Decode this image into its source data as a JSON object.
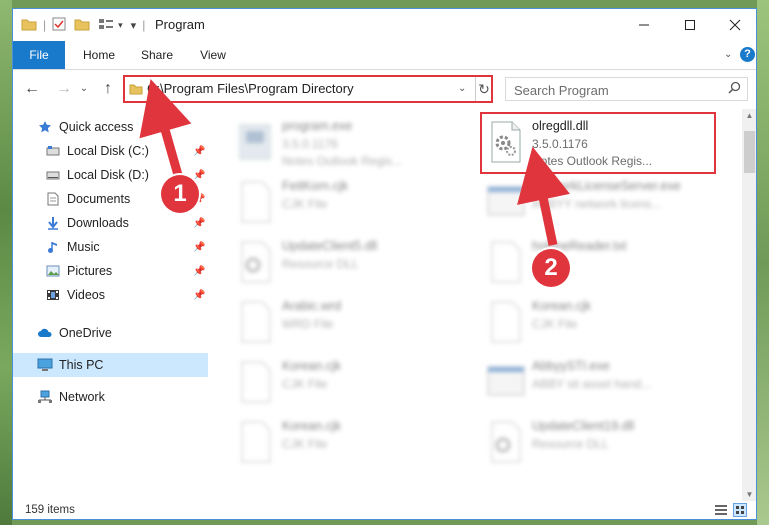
{
  "window": {
    "title": "Program"
  },
  "ribbon": {
    "tabs": [
      "File",
      "Home",
      "Share",
      "View"
    ]
  },
  "nav": {
    "address_path": "C:\\Program Files\\Program Directory",
    "search_placeholder": "Search Program"
  },
  "sidebar": {
    "items": [
      {
        "label": "Quick access",
        "icon": "star-icon"
      },
      {
        "label": "Local Disk (C:)",
        "icon": "drive-icon",
        "pinned": true
      },
      {
        "label": "Local Disk (D:)",
        "icon": "drive-icon",
        "pinned": true
      },
      {
        "label": "Documents",
        "icon": "documents-icon",
        "pinned": true
      },
      {
        "label": "Downloads",
        "icon": "download-icon",
        "pinned": true
      },
      {
        "label": "Music",
        "icon": "music-icon",
        "pinned": true
      },
      {
        "label": "Pictures",
        "icon": "pictures-icon",
        "pinned": true
      },
      {
        "label": "Videos",
        "icon": "videos-icon",
        "pinned": true
      },
      {
        "label": "OneDrive",
        "icon": "cloud-icon"
      },
      {
        "label": "This PC",
        "icon": "computer-icon",
        "selected": true
      },
      {
        "label": "Network",
        "icon": "network-icon"
      }
    ]
  },
  "files": [
    {
      "name": "program.exe",
      "line2": "3.5.0.1176",
      "line3": "Notes Outlook Regis...",
      "type": "exe",
      "blurred": true
    },
    {
      "name": "olregdll.dll",
      "line2": "3.5.0.1176",
      "line3": "Notes Outlook Regis...",
      "type": "dll",
      "blurred": false,
      "highlighted": true
    },
    {
      "name": "FeitKorn.cjk",
      "line2": "CJK File",
      "line3": "",
      "type": "blank",
      "blurred": true
    },
    {
      "name": "NetworkLicenseServer.exe",
      "line2": "ABBYY network licens...",
      "line3": "",
      "type": "exe-window",
      "blurred": true
    },
    {
      "name": "UpdateClient5.dll",
      "line2": "Resource DLL",
      "line3": "",
      "type": "dll",
      "blurred": true
    },
    {
      "name": "hotfineReader.txt",
      "line2": "",
      "line3": "",
      "type": "blank",
      "blurred": true
    },
    {
      "name": "Arabic.wrd",
      "line2": "WRD File",
      "line3": "",
      "type": "blank",
      "blurred": true
    },
    {
      "name": "Korean.cjk",
      "line2": "CJK File",
      "line3": "",
      "type": "blank",
      "blurred": true
    },
    {
      "name": "Korean.cjk",
      "line2": "CJK File",
      "line3": "",
      "type": "blank",
      "blurred": true
    },
    {
      "name": "AbbyySTI.exe",
      "line2": "ABBY sti asset hand...",
      "line3": "",
      "type": "exe-window",
      "blurred": true
    },
    {
      "name": "Korean.cjk",
      "line2": "CJK File",
      "line3": "",
      "type": "blank",
      "blurred": true
    },
    {
      "name": "UpdateClient19.dll",
      "line2": "Resource DLL",
      "line3": "",
      "type": "dll",
      "blurred": true
    }
  ],
  "status": {
    "item_count": "159 items"
  },
  "annotations": {
    "step1": "1",
    "step2": "2"
  },
  "colors": {
    "accent": "#1979ca",
    "highlight": "#e0353c",
    "selected_bg": "#cce8ff"
  }
}
